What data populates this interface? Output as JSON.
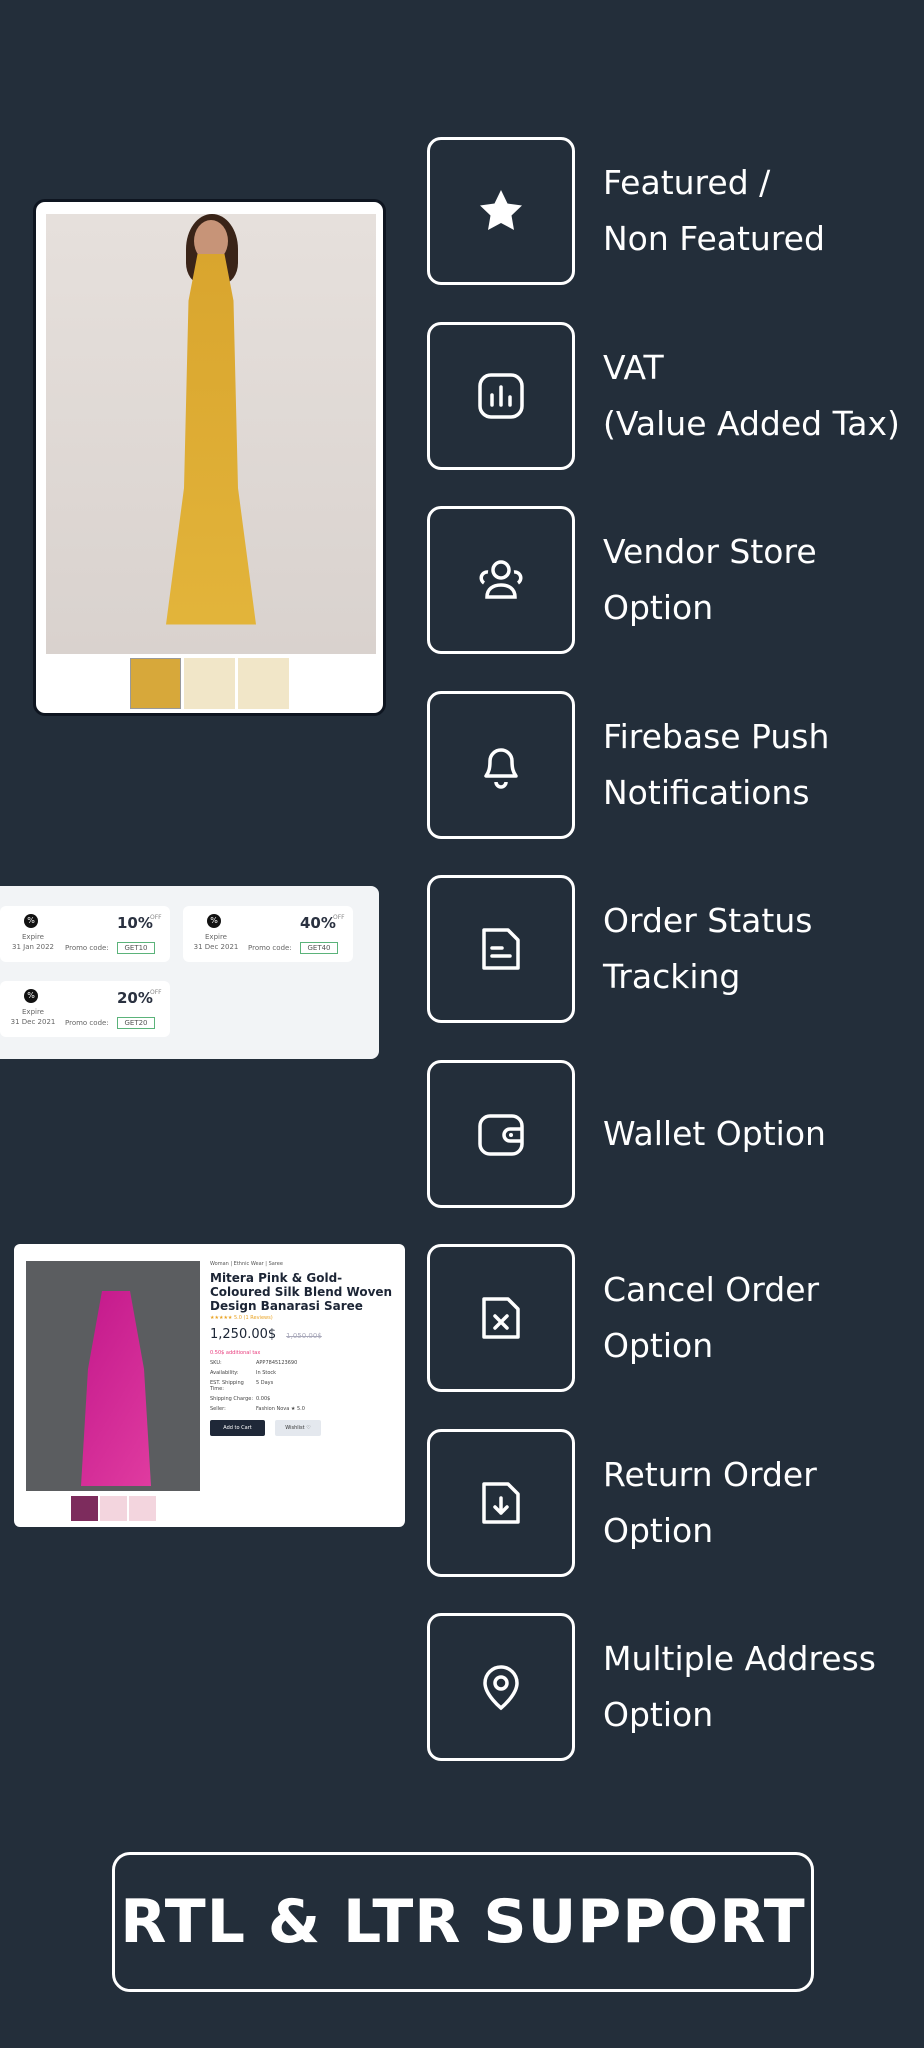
{
  "features": [
    {
      "label": "Featured /\nNon Featured",
      "icon": "star-icon"
    },
    {
      "label": "VAT\n(Value Added Tax)",
      "icon": "chart-icon"
    },
    {
      "label": "Vendor Store\nOption",
      "icon": "users-icon"
    },
    {
      "label": "Firebase  Push\nNotifications",
      "icon": "bell-icon"
    },
    {
      "label": "Order Status\nTracking",
      "icon": "document-icon"
    },
    {
      "label": "Wallet Option",
      "icon": "wallet-icon"
    },
    {
      "label": "Cancel Order\nOption",
      "icon": "file-cancel-icon"
    },
    {
      "label": "Return Order\nOption",
      "icon": "file-download-icon"
    },
    {
      "label": "Multiple Address\nOption",
      "icon": "location-icon"
    }
  ],
  "coupons": [
    {
      "expire_label": "Expire",
      "date": "31 Jan 2022",
      "promo_label": "Promo code:",
      "percent": "10%",
      "off": "OFF",
      "code": "GET10"
    },
    {
      "expire_label": "Expire",
      "date": "31 Dec 2021",
      "promo_label": "Promo code:",
      "percent": "40%",
      "off": "OFF",
      "code": "GET40"
    },
    {
      "expire_label": "Expire",
      "date": "31 Dec 2021",
      "promo_label": "Promo code:",
      "percent": "20%",
      "off": "OFF",
      "code": "GET20"
    }
  ],
  "product": {
    "breadcrumb": "Woman | Ethnic Wear | Saree",
    "title": "Mitera Pink & Gold-Coloured Silk Blend Woven Design Banarasi Saree",
    "rating": "★★★★★ 5.0  (1 Reviews)",
    "price": "1,250.00$",
    "old_price": "1,050.00$",
    "tax": "0.50$ additional tax",
    "details": [
      {
        "k": "SKU:",
        "v": "APP7845123690"
      },
      {
        "k": "Availability:",
        "v": "In Stock"
      },
      {
        "k": "EST. Shipping Time:",
        "v": "5 Days"
      },
      {
        "k": "Shipping Charge:",
        "v": "0.00$"
      },
      {
        "k": "Seller:",
        "v": "Fashion Nova ★ 5.0"
      }
    ],
    "add_to_cart": "Add to Cart",
    "wishlist": "Wishlist ♡"
  },
  "rtl_label": "RTL & LTR SUPPORT"
}
